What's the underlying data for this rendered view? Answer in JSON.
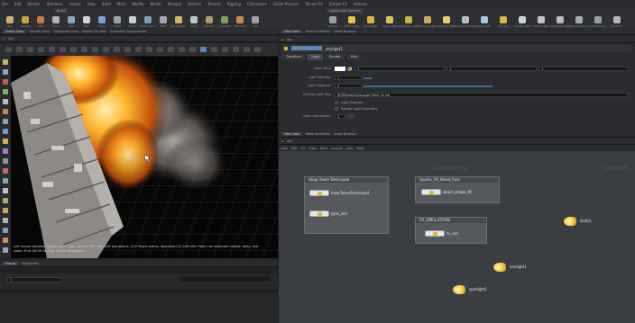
{
  "menubar": [
    "File",
    "Edit",
    "Render",
    "Windows",
    "Assets",
    "Help",
    "Build",
    "Main",
    "Modify",
    "Model",
    "Polygon",
    "Deform",
    "Texture",
    "Rigging",
    "Characters",
    "Guide Process",
    "Terrain FX",
    "Simple FX",
    "Volume"
  ],
  "shelf": {
    "left_tab": "Build",
    "right_tab": "Lights and Cameras",
    "left_tools": [
      {
        "label": "Box",
        "color": "#c9b16a"
      },
      {
        "label": "Sphere",
        "color": "#d0a040"
      },
      {
        "label": "Tube",
        "color": "#c47f3a"
      },
      {
        "label": "Torus",
        "color": "#b0b3b6"
      },
      {
        "label": "Grid",
        "color": "#8fa6c0"
      },
      {
        "label": "Null",
        "color": "#cfd2d6"
      },
      {
        "label": "Line",
        "color": "#7fa0c8"
      },
      {
        "label": "Circle",
        "color": "#9aa0a6"
      },
      {
        "label": "Curve",
        "color": "#c6ccd2"
      },
      {
        "label": "Draw Curve",
        "color": "#7d9bc1"
      },
      {
        "label": "Path",
        "color": "#a0a6ac"
      },
      {
        "label": "Spray Paint",
        "color": "#d7b55a"
      },
      {
        "label": "Font",
        "color": "#bfc3c8"
      },
      {
        "label": "Platonic",
        "color": "#b29a6a"
      },
      {
        "label": "L-System",
        "color": "#7ea15d"
      },
      {
        "label": "Metaball",
        "color": "#c78b4a"
      },
      {
        "label": "File",
        "color": "#9ba1a7"
      }
    ],
    "right_tools": [
      {
        "label": "Camera",
        "color": "#9aa0a6"
      },
      {
        "label": "Point Light",
        "color": "#e8c23c"
      },
      {
        "label": "Spot Light",
        "color": "#e2b532"
      },
      {
        "label": "Area Light",
        "color": "#d9c15b"
      },
      {
        "label": "Geometry Light",
        "color": "#c9b24a"
      },
      {
        "label": "Volume Light",
        "color": "#cba84b"
      },
      {
        "label": "Distant Light",
        "color": "#e7cf63"
      },
      {
        "label": "Environment Light",
        "color": "#b7bcc2"
      },
      {
        "label": "Sky Light",
        "color": "#a6c5e0"
      },
      {
        "label": "GI Light",
        "color": "#d9b04a"
      },
      {
        "label": "Caustic Light",
        "color": "#ccd1d6"
      },
      {
        "label": "Portal Light",
        "color": "#bfc3c8"
      },
      {
        "label": "Ambient Light",
        "color": "#b8bcc1"
      },
      {
        "label": "Stereo Camera",
        "color": "#a4aab0"
      },
      {
        "label": "VR Camera",
        "color": "#9aa0a6"
      },
      {
        "label": "Switcher",
        "color": "#b2b6bb"
      }
    ]
  },
  "viewport": {
    "tabs": [
      "Scene View",
      "Render View",
      "Composite View",
      "Motion FX View",
      "Geometry Spreadsheet"
    ],
    "path": "obj",
    "persp_label": "Persp",
    "cam_label": "No cam",
    "status_text": "Left mouse tumbles. Middle pans. Right dollies. Ctrl+Alt+Left box-zooms. Ctrl+Right zooms. Spacebar-Ctrl-Left tilts. Hold L for alternate tumble, dolly, and zoom. M or Alt+M for First Person Navigation."
  },
  "timeline": {
    "tabs": [
      "Frame",
      "Keyframes"
    ],
    "frame": "1"
  },
  "params": {
    "tabs": [
      "Tree View",
      "Material Palette",
      "Asset Browser"
    ],
    "path": "obj",
    "node_name": "envlight1",
    "sections": [
      "Transform",
      "Light",
      "Render",
      "Misc"
    ],
    "light_color_label": "Light Color",
    "light_color": [
      "1",
      "1",
      "1"
    ],
    "intensity_label": "Light Intensity",
    "intensity": "1",
    "exposure_label": "Light Exposure",
    "exposure": "0",
    "envmap_label": "Environment Map",
    "envmap": "$HIP/textures/sunset_field_2k.hdr",
    "check1": "Light Enabled",
    "check2": "Render Light Geometry",
    "sampling_label": "Light Contribution",
    "sampling": "0"
  },
  "network": {
    "tabs": [
      "Tree View",
      "Material Palette",
      "Asset Browser"
    ],
    "menu": [
      "Add",
      "Edit",
      "Go",
      "View",
      "Tools",
      "Layout",
      "Labs",
      "Help"
    ],
    "watermark_left": "Geometry",
    "watermark_right": "Objects",
    "boxes": [
      {
        "title": "Hoop Tower Destroyed",
        "nodes": [
          "hoopTowerDestroyed",
          "pyro_sim"
        ]
      },
      {
        "title": "Sparks_Fill_Wood_Pyro",
        "nodes": [
          "wood_smoke_fill"
        ]
      },
      {
        "title": "FX_SIMULATIONS",
        "nodes": [
          "fx_sim"
        ]
      }
    ],
    "lights": [
      {
        "label": "distlt1",
        "color": "#f0c534"
      },
      {
        "label": "envlight1",
        "color": "#f2c530"
      },
      {
        "label": "spotlight1",
        "color": "#ecbf2e"
      }
    ]
  }
}
